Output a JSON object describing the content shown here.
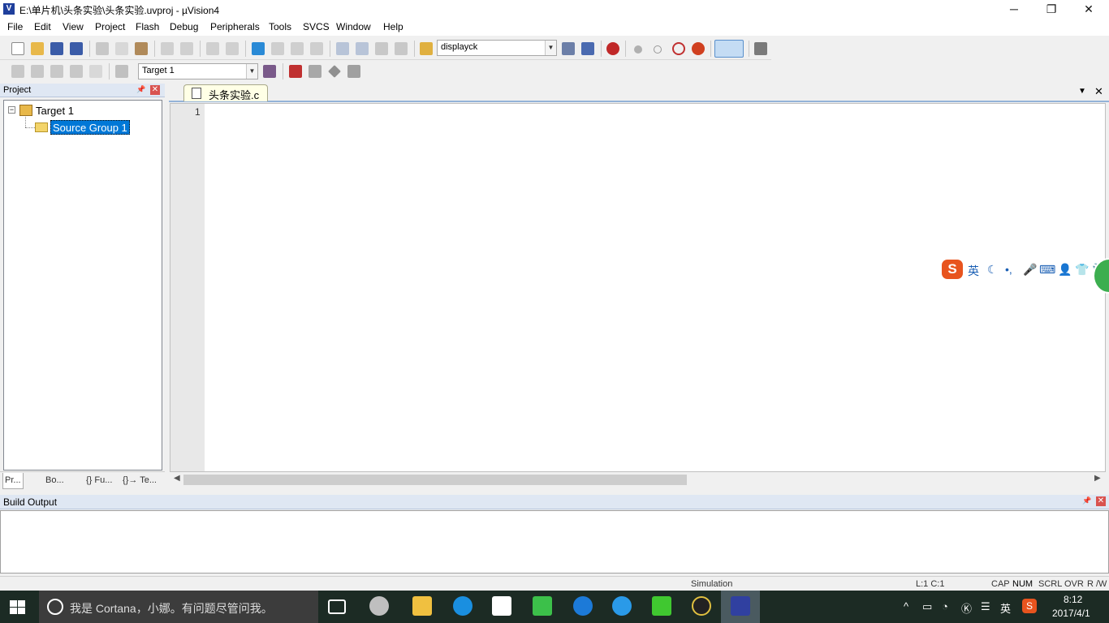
{
  "window": {
    "title": "E:\\单片机\\头条实验\\头条实验.uvproj - µVision4",
    "icon_label": "V",
    "controls": {
      "minimize": "─",
      "maximize": "❐",
      "close": "✕"
    }
  },
  "menubar": [
    "File",
    "Edit",
    "View",
    "Project",
    "Flash",
    "Debug",
    "Peripherals",
    "Tools",
    "SVCS",
    "Window",
    "Help"
  ],
  "toolbar1": {
    "find_combo": "displayck"
  },
  "toolbar2": {
    "target_combo": "Target 1"
  },
  "project_panel": {
    "title": "Project",
    "tree": {
      "root": "Target 1",
      "group": "Source Group 1"
    },
    "tabs": [
      "Pr...",
      "Bo...",
      "{} Fu...",
      "{}→ Te..."
    ]
  },
  "editor": {
    "tab_label": "头条实验.c",
    "line_numbers": [
      "1"
    ]
  },
  "build_output": {
    "title": "Build Output"
  },
  "status_bar": {
    "mode": "Simulation",
    "position": "L:1 C:1",
    "indicators": [
      "CAP",
      "NUM",
      "SCRL",
      "OVR",
      "R /W"
    ]
  },
  "ime": {
    "lang": "英"
  },
  "taskbar": {
    "cortana_placeholder": "我是 Cortana，小娜。有问题尽管问我。",
    "tray_lang": "英",
    "clock_time": "8:12",
    "clock_date": "2017/4/1"
  },
  "colors": {
    "selection": "#0078d7",
    "panel_header": "#dfe7f3",
    "taskbar": "#1c2b24",
    "editor_tab": "#ffffe6"
  }
}
